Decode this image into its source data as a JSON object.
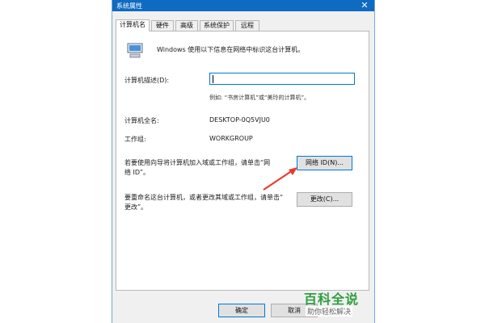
{
  "window": {
    "title": "系统属性",
    "close_glyph": "✕"
  },
  "tabs": [
    {
      "label": "计算机名",
      "active": true
    },
    {
      "label": "硬件"
    },
    {
      "label": "高级"
    },
    {
      "label": "系统保护"
    },
    {
      "label": "远程"
    }
  ],
  "panel": {
    "intro": "Windows 使用以下信息在网络中标识这台计算机。",
    "description_label": "计算机描述(D):",
    "description_value": "",
    "example": "例如: “书房计算机”或“美玲的计算机”。",
    "fullname_label": "计算机全名:",
    "fullname_value": "DESKTOP-0Q5VJU0",
    "workgroup_label": "工作组:",
    "workgroup_value": "WORKGROUP",
    "network_text_1": "若要使用向导将计算机加入域或工作组，请单击“网",
    "network_text_2": "络 ID”。",
    "network_button": "网络 ID(N)...",
    "rename_text_1": "要重命名这台计算机，或者更改其域或工作组，请单击“",
    "rename_text_2": "更改”。",
    "change_button": "更改(C)..."
  },
  "footer": {
    "ok": "确定",
    "cancel": "取消"
  },
  "watermark": {
    "title": "百科全说",
    "subtitle": "助你轻松解决"
  },
  "colors": {
    "titlebar": "#0f6ac2",
    "arrow": "#e8392d",
    "watermark": "#2e9e3e"
  }
}
